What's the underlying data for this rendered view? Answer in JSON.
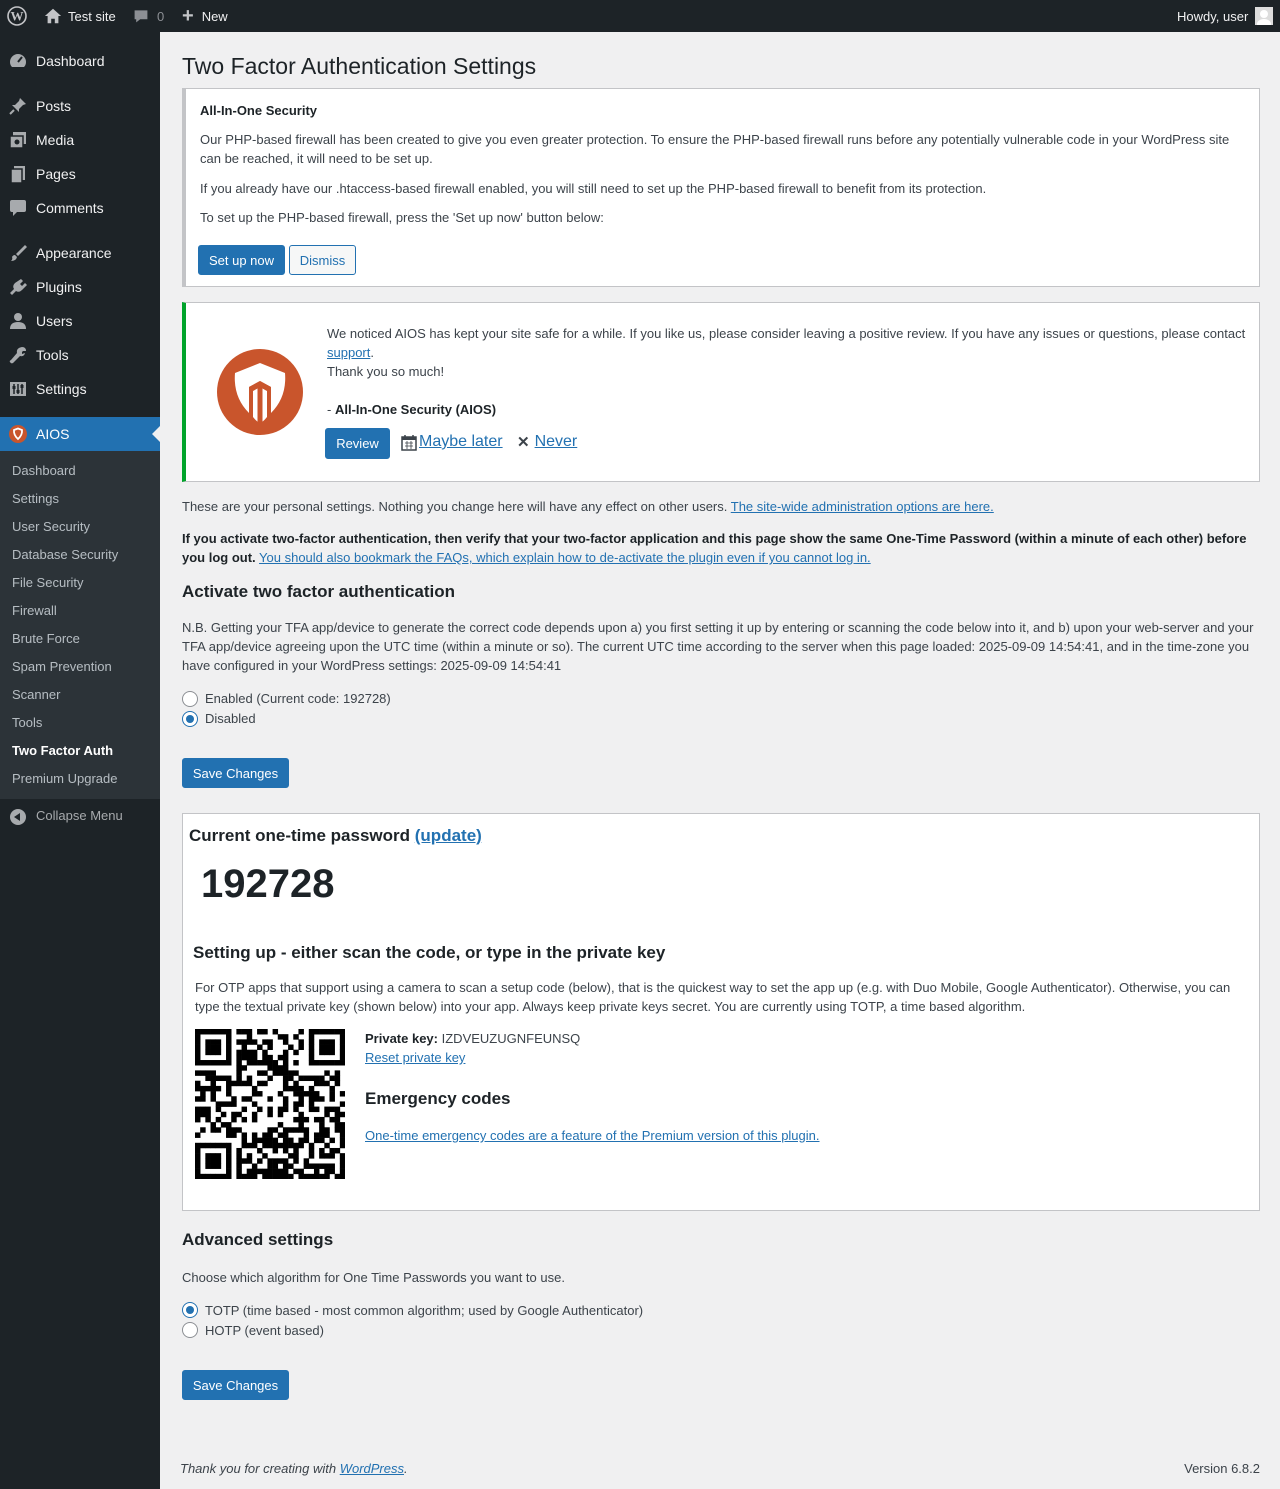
{
  "adminbar": {
    "site_name": "Test site",
    "comment_count": "0",
    "new_label": "New",
    "howdy": "Howdy, user"
  },
  "menu": {
    "dashboard": "Dashboard",
    "posts": "Posts",
    "media": "Media",
    "pages": "Pages",
    "comments": "Comments",
    "appearance": "Appearance",
    "plugins": "Plugins",
    "users": "Users",
    "tools": "Tools",
    "settings": "Settings",
    "aios": "AIOS",
    "collapse": "Collapse Menu",
    "sub": [
      "Dashboard",
      "Settings",
      "User Security",
      "Database Security",
      "File Security",
      "Firewall",
      "Brute Force",
      "Spam Prevention",
      "Scanner",
      "Tools",
      "Two Factor Auth",
      "Premium Upgrade"
    ]
  },
  "page_title": "Two Factor Authentication Settings",
  "firewall_notice": {
    "title": "All-In-One Security",
    "p1": "Our PHP-based firewall has been created to give you even greater protection. To ensure the PHP-based firewall runs before any potentially vulnerable code in your WordPress site can be reached, it will need to be set up.",
    "p2": "If you already have our .htaccess-based firewall enabled, you will still need to set up the PHP-based firewall to benefit from its protection.",
    "p3": "To set up the PHP-based firewall, press the 'Set up now' button below:",
    "setup_label": "Set up now",
    "dismiss_label": "Dismiss"
  },
  "review_notice": {
    "text_a": "We noticed AIOS has kept your site safe for a while. If you like us, please consider leaving a positive review. If you have any issues or questions, please contact ",
    "support_link": "support",
    "text_b": ".",
    "thanks": "Thank you so much!",
    "sig_prefix": "- ",
    "sig": "All-In-One Security (AIOS)",
    "review_label": "Review",
    "later_label": "Maybe later",
    "never_label": "Never"
  },
  "intro": {
    "text": "These are your personal settings. Nothing you change here will have any effect on other users. ",
    "link": "The site-wide administration options are here."
  },
  "warning": {
    "bold": "If you activate two-factor authentication, then verify that your two-factor application and this page show the same One-Time Password (within a minute of each other) before you log out.",
    "link": "You should also bookmark the FAQs, which explain how to de-activate the plugin even if you cannot log in."
  },
  "activate": {
    "heading": "Activate two factor authentication",
    "nb": "N.B. Getting your TFA app/device to generate the correct code depends upon a) you first setting it up by entering or scanning the code below into it, and b) upon your web-server and your TFA app/device agreeing upon the UTC time (within a minute or so). The current UTC time according to the server when this page loaded: 2025-09-09 14:54:41, and in the time-zone you have configured in your WordPress settings: 2025-09-09 14:54:41",
    "enabled_label": "Enabled (Current code: 192728)",
    "disabled_label": "Disabled",
    "selected": "disabled",
    "save_label": "Save Changes"
  },
  "otp": {
    "heading": "Current one-time password ",
    "update_link": "(update)",
    "code": "192728",
    "setup_heading": "Setting up - either scan the code, or type in the private key",
    "setup_text": "For OTP apps that support using a camera to scan a setup code (below), that is the quickest way to set the app up (e.g. with Duo Mobile, Google Authenticator). Otherwise, you can type the textual private key (shown below) into your app. Always keep private keys secret. You are currently using TOTP, a time based algorithm.",
    "private_key_label": "Private key:",
    "private_key": "IZDVEUZUGNFEUNSQ",
    "reset_link": "Reset private key",
    "emergency_heading": "Emergency codes",
    "emergency_link": "One-time emergency codes are a feature of the Premium version of this plugin."
  },
  "advanced": {
    "heading": "Advanced settings",
    "desc": "Choose which algorithm for One Time Passwords you want to use.",
    "totp_label": "TOTP (time based - most common algorithm; used by Google Authenticator)",
    "hotp_label": "HOTP (event based)",
    "selected": "totp",
    "save_label": "Save Changes"
  },
  "footer": {
    "thanks": "Thank you for creating with ",
    "wp_link": "WordPress",
    "period": ".",
    "version": "Version 6.8.2"
  },
  "colors": {
    "admin_bg": "#1d2327",
    "accent": "#2271b1",
    "aios_brand": "#c9552c",
    "success_border": "#00a32a"
  }
}
